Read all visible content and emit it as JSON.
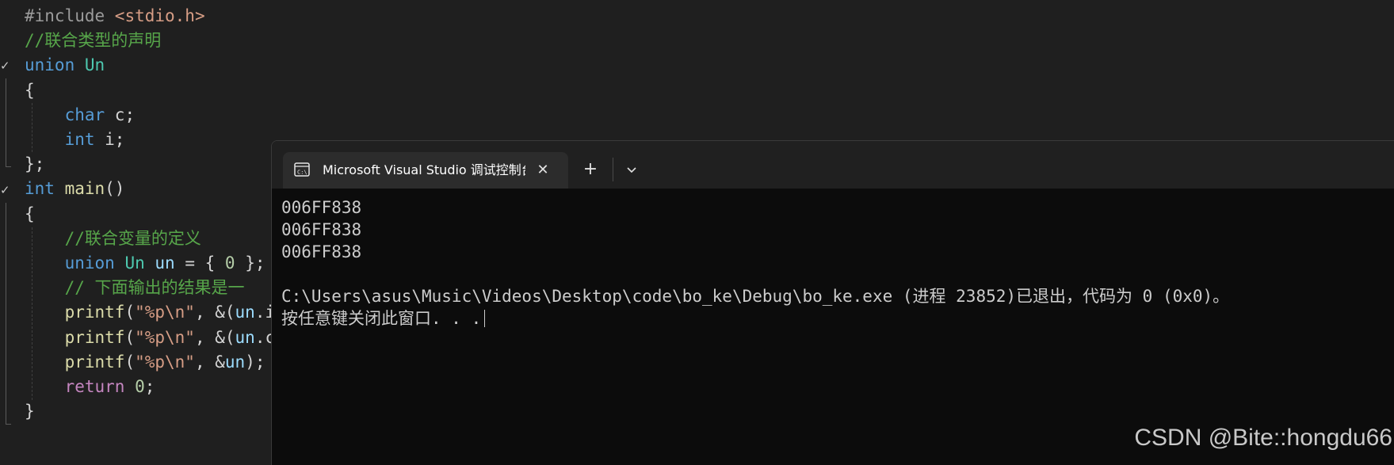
{
  "editor": {
    "lines": [
      {
        "segments": [
          {
            "t": "#include ",
            "c": "pre"
          },
          {
            "t": "<stdio.h>",
            "c": "str"
          }
        ]
      },
      {
        "segments": [
          {
            "t": "//联合类型的声明",
            "c": "cmt"
          }
        ]
      },
      {
        "segments": [
          {
            "t": "union ",
            "c": "kw"
          },
          {
            "t": "Un",
            "c": "typ"
          }
        ]
      },
      {
        "segments": [
          {
            "t": "{",
            "c": "punc"
          }
        ]
      },
      {
        "segments": [
          {
            "t": "    ",
            "c": "punc"
          },
          {
            "t": "char ",
            "c": "kw"
          },
          {
            "t": "c;",
            "c": "punc"
          }
        ]
      },
      {
        "segments": [
          {
            "t": "    ",
            "c": "punc"
          },
          {
            "t": "int ",
            "c": "kw"
          },
          {
            "t": "i;",
            "c": "punc"
          }
        ]
      },
      {
        "segments": [
          {
            "t": "};",
            "c": "punc"
          }
        ]
      },
      {
        "segments": [
          {
            "t": "int ",
            "c": "kw"
          },
          {
            "t": "main",
            "c": "fn"
          },
          {
            "t": "()",
            "c": "punc"
          }
        ]
      },
      {
        "segments": [
          {
            "t": "{",
            "c": "punc"
          }
        ]
      },
      {
        "segments": [
          {
            "t": "    ",
            "c": "punc"
          },
          {
            "t": "//联合变量的定义",
            "c": "cmt"
          }
        ]
      },
      {
        "segments": [
          {
            "t": "    ",
            "c": "punc"
          },
          {
            "t": "union ",
            "c": "kw"
          },
          {
            "t": "Un ",
            "c": "typ"
          },
          {
            "t": "un",
            "c": "var"
          },
          {
            "t": " = { ",
            "c": "punc"
          },
          {
            "t": "0",
            "c": "num"
          },
          {
            "t": " };",
            "c": "punc"
          }
        ]
      },
      {
        "segments": [
          {
            "t": "    ",
            "c": "punc"
          },
          {
            "t": "// 下面输出的结果是一",
            "c": "cmt"
          }
        ]
      },
      {
        "segments": [
          {
            "t": "    ",
            "c": "punc"
          },
          {
            "t": "printf",
            "c": "fn"
          },
          {
            "t": "(",
            "c": "punc"
          },
          {
            "t": "\"%p\\n\"",
            "c": "str"
          },
          {
            "t": ", &(",
            "c": "punc"
          },
          {
            "t": "un",
            "c": "var"
          },
          {
            "t": ".i",
            "c": "punc"
          }
        ]
      },
      {
        "segments": [
          {
            "t": "    ",
            "c": "punc"
          },
          {
            "t": "printf",
            "c": "fn"
          },
          {
            "t": "(",
            "c": "punc"
          },
          {
            "t": "\"%p\\n\"",
            "c": "str"
          },
          {
            "t": ", &(",
            "c": "punc"
          },
          {
            "t": "un",
            "c": "var"
          },
          {
            "t": ".c",
            "c": "punc"
          }
        ]
      },
      {
        "segments": [
          {
            "t": "    ",
            "c": "punc"
          },
          {
            "t": "printf",
            "c": "fn"
          },
          {
            "t": "(",
            "c": "punc"
          },
          {
            "t": "\"%p\\n\"",
            "c": "str"
          },
          {
            "t": ", &",
            "c": "punc"
          },
          {
            "t": "un",
            "c": "var"
          },
          {
            "t": ");",
            "c": "punc"
          }
        ]
      },
      {
        "segments": [
          {
            "t": "    ",
            "c": "punc"
          },
          {
            "t": "return ",
            "c": "kw2"
          },
          {
            "t": "0",
            "c": "num"
          },
          {
            "t": ";",
            "c": "punc"
          }
        ]
      },
      {
        "segments": [
          {
            "t": "}",
            "c": "punc"
          }
        ]
      }
    ]
  },
  "terminal": {
    "tab_title": "Microsoft Visual Studio 调试控制台",
    "tab_icon": "terminal-icon",
    "close_icon": "close-icon",
    "new_tab_icon": "plus-icon",
    "dropdown_icon": "chevron-down-icon",
    "close_glyph": "✕",
    "new_tab_glyph": "+",
    "output": [
      "006FF838",
      "006FF838",
      "006FF838",
      "",
      "C:\\Users\\asus\\Music\\Videos\\Desktop\\code\\bo_ke\\Debug\\bo_ke.exe (进程 23852)已退出，代码为 0 (0x0)。",
      "按任意键关闭此窗口. . ."
    ]
  },
  "watermark": "CSDN @Bite::hongdu66"
}
